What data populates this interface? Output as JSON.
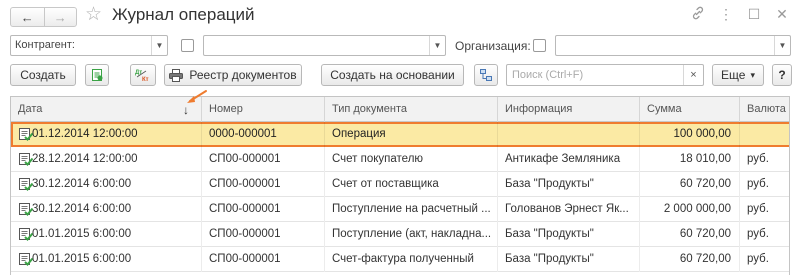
{
  "window": {
    "title": "Журнал операций",
    "nav_back": "←",
    "nav_forward": "→",
    "star": "☆",
    "icons": {
      "link": "🔗",
      "more": "⋮",
      "maximize": "☐",
      "close": "✕"
    }
  },
  "filters": {
    "contractor_label": "Контрагент:",
    "organization_label": "Организация:"
  },
  "toolbar": {
    "create": "Создать",
    "registry": "Реестр документов",
    "create_based_on": "Создать на основании",
    "search_placeholder": "Поиск (Ctrl+F)",
    "search_clear": "×",
    "more": "Еще",
    "more_caret": "▾"
  },
  "table": {
    "columns": [
      "Дата",
      "Номер",
      "Тип документа",
      "Информация",
      "Сумма",
      "Валюта"
    ],
    "sort_indicator": "↓",
    "rows": [
      {
        "date": "01.12.2014 12:00:00",
        "number": "0000-000001",
        "type": "Операция",
        "info": "",
        "sum": "100 000,00",
        "currency": "",
        "selected": true
      },
      {
        "date": "28.12.2014 12:00:00",
        "number": "СП00-000001",
        "type": "Счет покупателю",
        "info": "Антикафе Земляника",
        "sum": "18 010,00",
        "currency": "руб."
      },
      {
        "date": "30.12.2014 6:00:00",
        "number": "СП00-000001",
        "type": "Счет от поставщика",
        "info": "База \"Продукты\"",
        "sum": "60 720,00",
        "currency": "руб."
      },
      {
        "date": "30.12.2014 6:00:00",
        "number": "СП00-000001",
        "type": "Поступление на расчетный ...",
        "info": "Голованов Эрнест Як...",
        "sum": "2 000 000,00",
        "currency": "руб."
      },
      {
        "date": "01.01.2015 6:00:00",
        "number": "СП00-000001",
        "type": "Поступление (акт, накладна...",
        "info": "База \"Продукты\"",
        "sum": "60 720,00",
        "currency": "руб."
      },
      {
        "date": "01.01.2015 6:00:00",
        "number": "СП00-000001",
        "type": "Счет-фактура полученный",
        "info": "База \"Продукты\"",
        "sum": "60 720,00",
        "currency": "руб."
      }
    ]
  },
  "colors": {
    "selection": "#fbeaa4",
    "highlight": "#ef7c2f",
    "doc_icon": "#3aa345"
  }
}
